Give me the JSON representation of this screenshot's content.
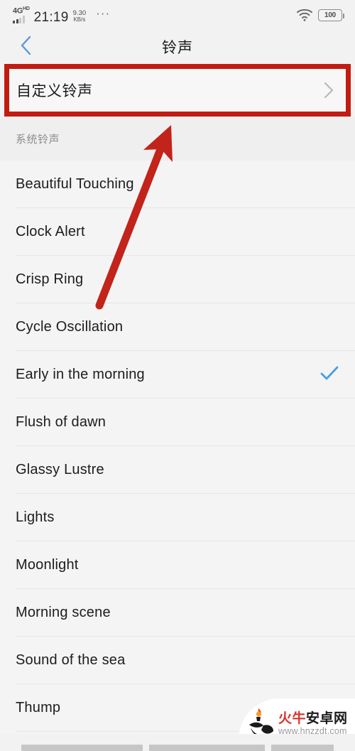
{
  "statusbar": {
    "network_label": "4G",
    "network_sup": "HD",
    "time": "21:19",
    "speed_value": "9.30",
    "speed_unit": "KB/s",
    "overflow": "···",
    "wifi_icon": "wifi-icon",
    "battery_level": "100"
  },
  "header": {
    "back_icon": "back-chevron-icon",
    "title": "铃声"
  },
  "custom_ringtone": {
    "label": "自定义铃声",
    "chevron_icon": "chevron-right-icon",
    "highlight_color": "#c21b12"
  },
  "section": {
    "title": "系统铃声"
  },
  "ringtones": [
    {
      "name": "Beautiful Touching",
      "selected": false
    },
    {
      "name": "Clock Alert",
      "selected": false
    },
    {
      "name": "Crisp Ring",
      "selected": false
    },
    {
      "name": "Cycle Oscillation",
      "selected": false
    },
    {
      "name": "Early in the morning",
      "selected": true
    },
    {
      "name": "Flush of dawn",
      "selected": false
    },
    {
      "name": "Glassy Lustre",
      "selected": false
    },
    {
      "name": "Lights",
      "selected": false
    },
    {
      "name": "Moonlight",
      "selected": false
    },
    {
      "name": "Morning scene",
      "selected": false
    },
    {
      "name": "Sound of the sea",
      "selected": false
    },
    {
      "name": "Thump",
      "selected": false
    }
  ],
  "annotation": {
    "arrow_icon": "red-arrow-annotation",
    "color": "#c2231a"
  },
  "watermark": {
    "logo_icon": "torch-logo-icon",
    "name_red": "火牛",
    "name_dark": "安卓网",
    "url": "www.hnzzdt.com"
  },
  "navbar": {
    "recents_icon": "recents-nav-pill",
    "home_icon": "home-nav-pill",
    "back_icon": "back-nav-pill"
  },
  "colors": {
    "accent_blue": "#4a9fe0",
    "highlight_red": "#c21b12",
    "background": "#f4f4f4"
  }
}
